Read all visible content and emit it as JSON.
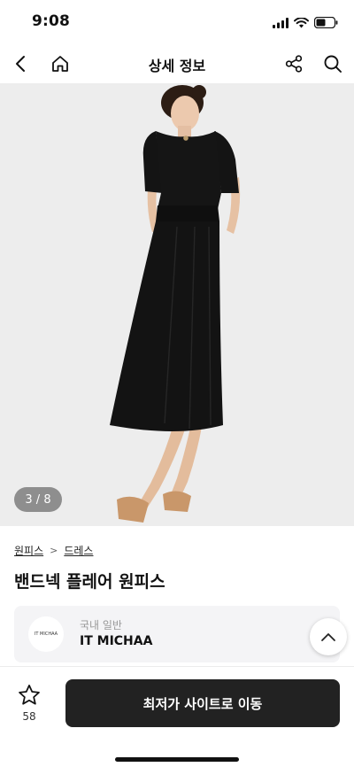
{
  "status": {
    "time": "9:08"
  },
  "nav": {
    "title": "상세 정보"
  },
  "gallery": {
    "counter": "3 / 8"
  },
  "breadcrumb": {
    "items": [
      "원피스",
      "드레스"
    ],
    "separator": ">"
  },
  "product": {
    "name": "밴드넥 플레어 원피스"
  },
  "shop": {
    "type": "국내 일반",
    "name": "IT MICHAA",
    "logo_text": "IT MICHAA"
  },
  "favorite": {
    "count": "58"
  },
  "cta": {
    "label": "최저가 사이트로 이동"
  },
  "colors": {
    "cta_bg": "#222222",
    "card_bg": "#f4f4f6",
    "hero_bg": "#ededed"
  },
  "icons": [
    "back-icon",
    "home-icon",
    "share-icon",
    "search-icon",
    "star-icon",
    "chevron-up-icon",
    "signal-icon",
    "wifi-icon",
    "battery-icon"
  ]
}
